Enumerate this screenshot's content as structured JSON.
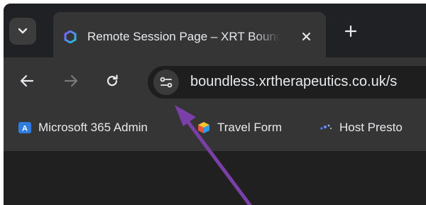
{
  "tab": {
    "title": "Remote Session Page – XRT Boundless",
    "close_glyph": "✕",
    "favicon": "xrt-logo-icon"
  },
  "tabstrip": {
    "search_icon": "chevron-down-icon",
    "new_tab_glyph": "+"
  },
  "toolbar": {
    "back_icon": "arrow-left-icon",
    "forward_icon": "arrow-right-icon",
    "reload_icon": "reload-icon",
    "site_info_icon": "tune-icon",
    "url": "boundless.xrtherapeutics.co.uk/s"
  },
  "bookmarks": [
    {
      "label": "Microsoft 365 Admin",
      "icon": "ms365-admin-icon"
    },
    {
      "label": "Travel Form",
      "icon": "cube-icon"
    },
    {
      "label": "Host Presto",
      "icon": "sparkle-icon"
    }
  ],
  "colors": {
    "tabstrip_bg": "#202124",
    "toolbar_bg": "#353535",
    "omnibox_bg": "#1e1e1e",
    "text": "#e8eaed",
    "annotation_arrow": "#7b3fa8"
  }
}
